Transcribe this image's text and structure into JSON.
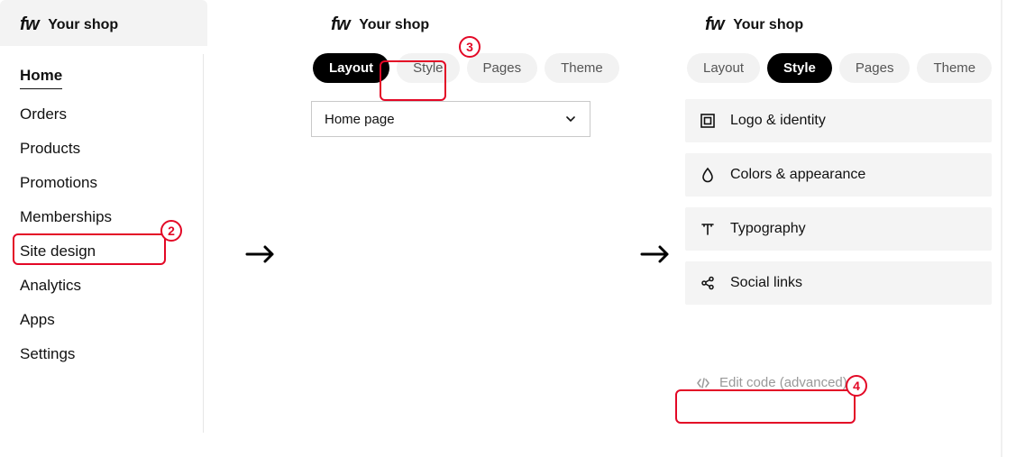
{
  "app": {
    "logo_text": "fw",
    "shop_name": "Your shop"
  },
  "nav": {
    "items": [
      "Home",
      "Orders",
      "Products",
      "Promotions",
      "Memberships",
      "Site design",
      "Analytics",
      "Apps",
      "Settings"
    ],
    "active_index": 0
  },
  "tabs": {
    "items": [
      "Layout",
      "Style",
      "Pages",
      "Theme"
    ],
    "panel2_active_index": 0,
    "panel3_active_index": 1
  },
  "page_select": {
    "value": "Home page"
  },
  "style_options": [
    {
      "icon": "logo",
      "label": "Logo & identity"
    },
    {
      "icon": "drop",
      "label": "Colors & appearance"
    },
    {
      "icon": "type",
      "label": "Typography"
    },
    {
      "icon": "share",
      "label": "Social links"
    }
  ],
  "edit_code": {
    "label": "Edit code (advanced)"
  },
  "annotations": {
    "step2": "2",
    "step3": "3",
    "step4": "4"
  },
  "colors": {
    "accent": "#e30826"
  }
}
